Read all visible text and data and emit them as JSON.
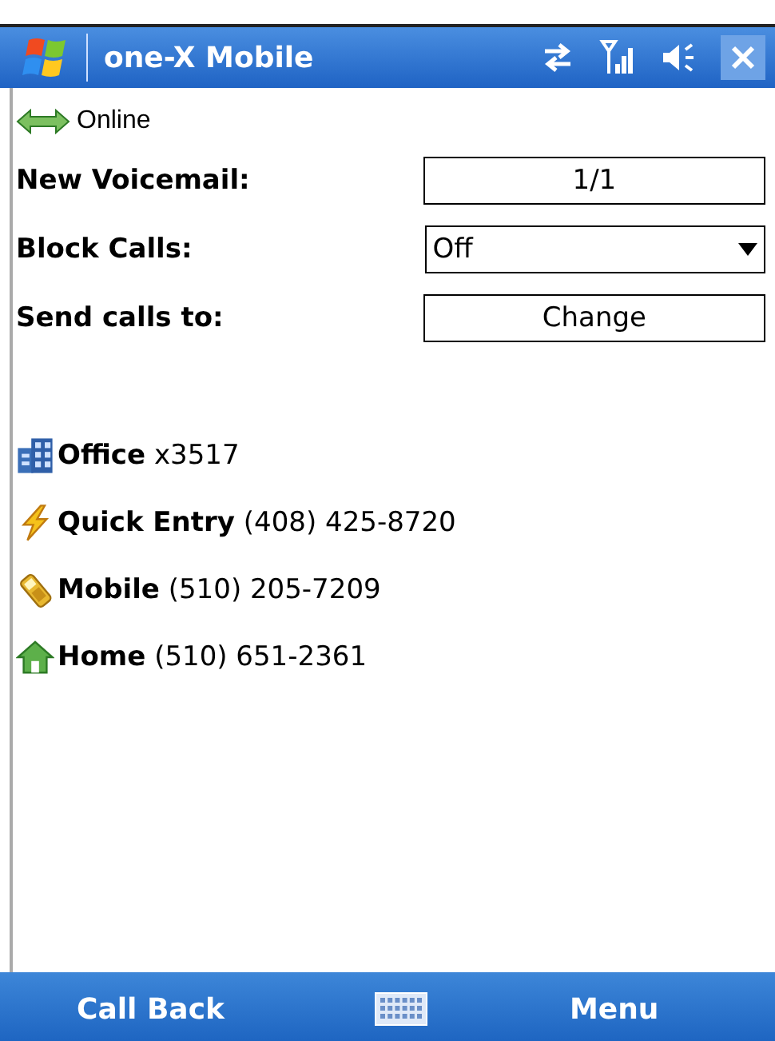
{
  "title_bar": {
    "title": "one-X Mobile"
  },
  "status": {
    "label": "Online"
  },
  "settings": [
    {
      "kind": "button",
      "label": "New Voicemail:",
      "value": "1/1"
    },
    {
      "kind": "dropdown",
      "label": "Block Calls:",
      "value": "Off"
    },
    {
      "kind": "button",
      "label": "Send calls to:",
      "value": "Change"
    }
  ],
  "destinations": [
    {
      "kind": "office",
      "name": "Office",
      "number": "x3517"
    },
    {
      "kind": "quick",
      "name": "Quick Entry",
      "number": "(408) 425-8720"
    },
    {
      "kind": "mobile",
      "name": "Mobile",
      "number": "(510) 205-7209"
    },
    {
      "kind": "home",
      "name": "Home",
      "number": "(510) 651-2361"
    }
  ],
  "softkeys": {
    "left": "Call Back",
    "right": "Menu"
  }
}
